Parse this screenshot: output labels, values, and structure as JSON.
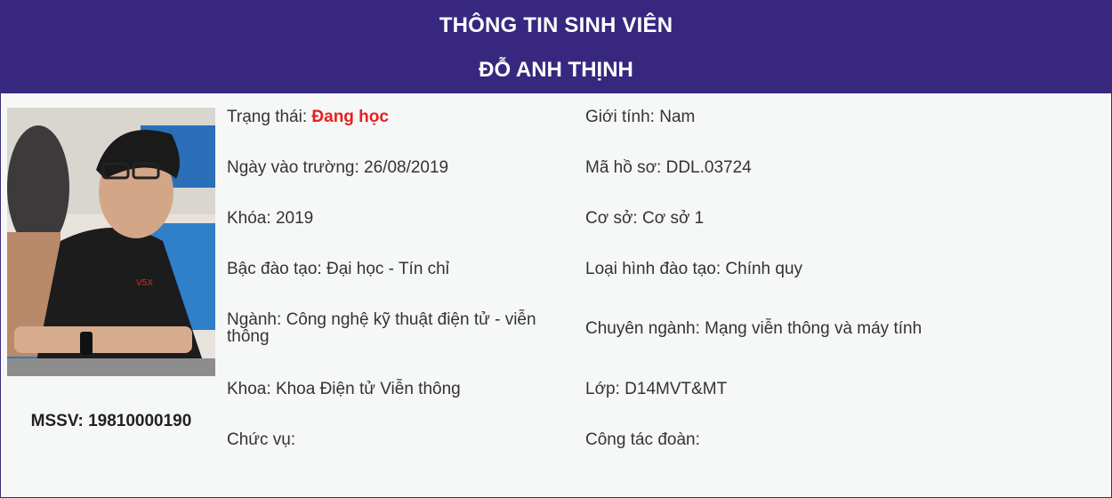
{
  "header": {
    "title": "THÔNG TIN SINH VIÊN",
    "student_name": "ĐỖ ANH THỊNH"
  },
  "profile": {
    "photo": "student-photo",
    "mssv_label": "MSSV:",
    "mssv_value": "19810000190"
  },
  "fields": {
    "status_label": "Trạng thái:",
    "status_value": "Đang học",
    "gender_label": "Giới tính:",
    "gender_value": "Nam",
    "enroll_label": "Ngày vào trường:",
    "enroll_value": "26/08/2019",
    "record_label": "Mã hồ sơ:",
    "record_value": "DDL.03724",
    "course_label": "Khóa:",
    "course_value": "2019",
    "campus_label": "Cơ sở:",
    "campus_value": "Cơ sở 1",
    "level_label": "Bậc đào tạo:",
    "level_value": "Đại học - Tín chỉ",
    "type_label": "Loại hình đào tạo:",
    "type_value": "Chính quy",
    "major_label": "Ngành:",
    "major_value": "Công nghệ kỹ thuật điện tử - viễn thông",
    "specialty_label": "Chuyên ngành:",
    "specialty_value": "Mạng viễn thông và máy tính",
    "faculty_label": "Khoa:",
    "faculty_value": "Khoa Điện tử Viễn thông",
    "class_label": "Lớp:",
    "class_value": "D14MVT&MT",
    "position_label": "Chức vụ:",
    "position_value": "",
    "union_label": "Công tác đoàn:",
    "union_value": ""
  },
  "colors": {
    "header_bg": "#37277f",
    "status_value": "#e8201f",
    "panel_bg": "#f6f8f7"
  }
}
